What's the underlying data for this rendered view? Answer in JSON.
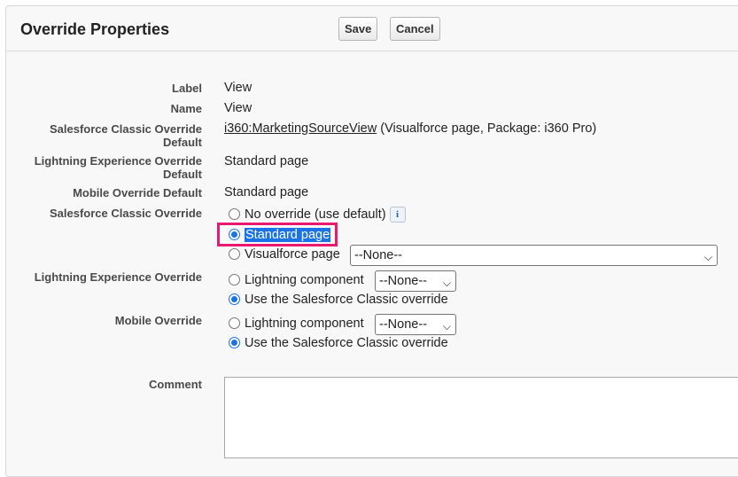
{
  "header": {
    "title": "Override Properties",
    "save_label": "Save",
    "cancel_label": "Cancel"
  },
  "fields": {
    "label": {
      "label": "Label",
      "value": "View"
    },
    "name": {
      "label": "Name",
      "value": "View"
    },
    "classic_default": {
      "label_line1": "Salesforce Classic Override",
      "label_line2": "Default",
      "link": "i360:MarketingSourceView",
      "suffix": " (Visualforce page, Package: i360 Pro)"
    },
    "lightning_default": {
      "label_line1": "Lightning Experience Override",
      "label_line2": "Default",
      "value": "Standard page"
    },
    "mobile_default": {
      "label": "Mobile Override Default",
      "value": "Standard page"
    }
  },
  "classic_override": {
    "label": "Salesforce Classic Override",
    "options": {
      "no_override": "No override (use default)",
      "standard": "Standard page",
      "visualforce": "Visualforce page"
    },
    "visualforce_select": "--None--",
    "selected": "standard",
    "info_icon": "i"
  },
  "lightning_override": {
    "label": "Lightning Experience Override",
    "component_label": "Lightning component",
    "component_select": "--None--",
    "use_classic_label": "Use the Salesforce Classic override",
    "selected": "use_classic"
  },
  "mobile_override": {
    "label": "Mobile Override",
    "component_label": "Lightning component",
    "component_select": "--None--",
    "use_classic_label": "Use the Salesforce Classic override",
    "selected": "use_classic"
  },
  "comment": {
    "label": "Comment",
    "value": ""
  },
  "colors": {
    "highlight_border": "#e8196e",
    "selection": "#1a73e8"
  }
}
